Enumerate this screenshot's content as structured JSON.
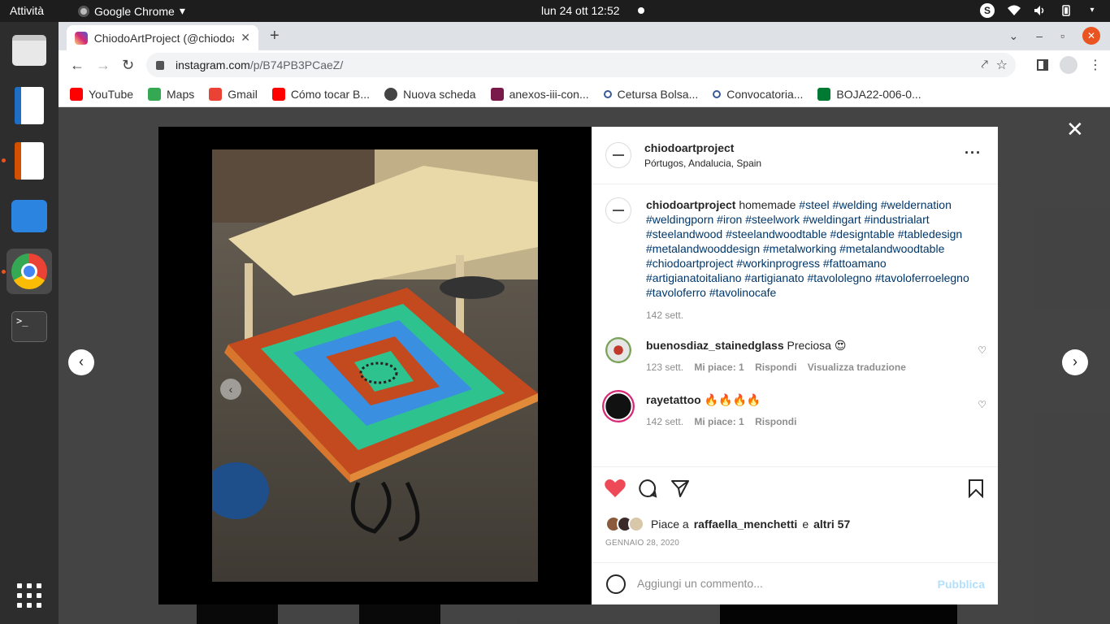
{
  "topbar": {
    "activities": "Attività",
    "app_name": "Google Chrome",
    "clock": "lun 24 ott  12:52"
  },
  "dock": {
    "items": [
      "files",
      "libreoffice-writer",
      "libreoffice-impress",
      "software-store",
      "google-chrome",
      "terminal",
      "show-applications"
    ],
    "terminal_glyph": ">_"
  },
  "browser": {
    "tab_title": "ChiodoArtProject (@chiodoartproject)",
    "tab_close": "✕",
    "new_tab": "+",
    "url_host": "instagram.com",
    "url_path": "/p/B74PB3PCaeZ/",
    "bookmarks": [
      {
        "label": "YouTube",
        "color": "#ff0000"
      },
      {
        "label": "Maps",
        "color": "#34a853"
      },
      {
        "label": "Gmail",
        "color": "#ea4335"
      },
      {
        "label": "Cómo tocar B...",
        "color": "#ff0000"
      },
      {
        "label": "Nuova scheda",
        "color": "#444444"
      },
      {
        "label": "anexos-iii-con...",
        "color": "#7a1a4a"
      },
      {
        "label": "Cetursa Bolsa...",
        "color": "#3b5998"
      },
      {
        "label": "Convocatoria...",
        "color": "#3b5998"
      },
      {
        "label": "BOJA22-006-0...",
        "color": "#007a33"
      }
    ]
  },
  "post": {
    "username": "chiodoartproject",
    "location": "Pórtugos, Andalucia, Spain",
    "more": "···",
    "caption_word": "homemade",
    "hashtags": "#steel #welding #weldernation #weldingporn #iron #steelwork #weldingart #industrialart #steelandwood #steelandwoodtable #designtable #tabledesign #metalandwooddesign #metalworking #metalandwoodtable #chiodoartproject #workinprogress #fattoamano #artigianatoitaliano #artigianato #tavololegno #tavoloferroelegno #tavoloferro #tavolinocafe",
    "caption_age": "142 sett.",
    "comments": [
      {
        "user": "buenosdiaz_stainedglass",
        "text": "Preciosa 😍",
        "age": "123 sett.",
        "likes": "Mi piace: 1",
        "reply": "Rispondi",
        "translate": "Visualizza traduzione"
      },
      {
        "user": "rayetattoo",
        "text": "🔥🔥🔥🔥",
        "age": "142 sett.",
        "likes": "Mi piace: 1",
        "reply": "Rispondi"
      }
    ],
    "liked_by_prefix": "Piace a",
    "liked_by_user": "raffaella_menchetti",
    "liked_by_and": "e",
    "liked_by_others": "altri 57",
    "date": "GENNAIO 28, 2020",
    "comment_placeholder": "Aggiungi un commento...",
    "publish": "Pubblica",
    "like_color": "#ed4956",
    "carousel": {
      "total": 5,
      "current": 5
    }
  }
}
